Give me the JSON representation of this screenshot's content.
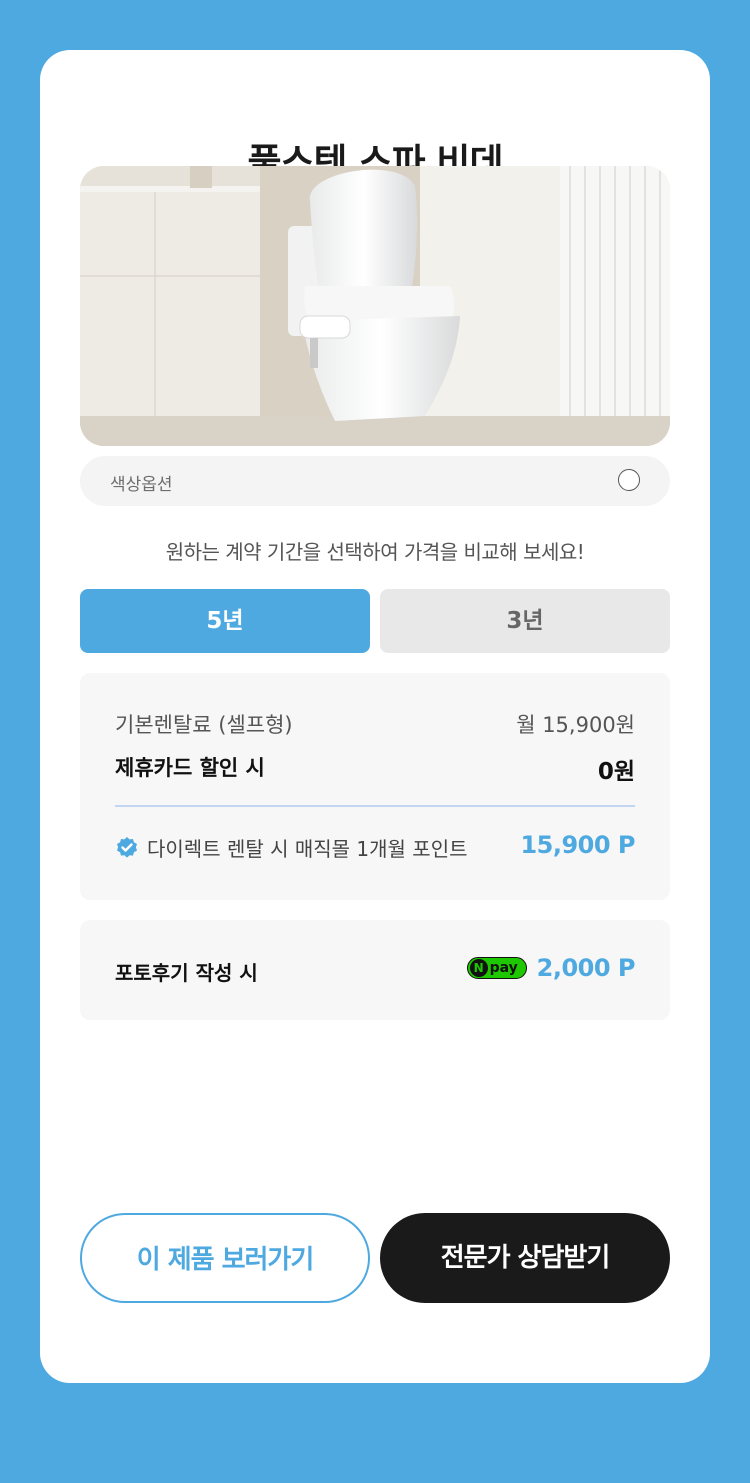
{
  "title": "풀스텐 스파 비데",
  "product_image": {
    "alt": "bidet-photo"
  },
  "color_option": {
    "label": "색상옵션"
  },
  "hint": "원하는 계약 기간을 선택하여 가격을 비교해 보세요!",
  "tabs": [
    {
      "label": "5년",
      "active": true
    },
    {
      "label": "3년",
      "active": false
    }
  ],
  "pricing": {
    "base_label": "기본렌탈료 (셀프형)",
    "base_value": "월 15,900원",
    "discount_label": "제휴카드 할인 시",
    "discount_value": "0원",
    "point_label": "다이렉트 렌탈 시 매직몰 1개월 포인트",
    "point_value": "15,900 P"
  },
  "review": {
    "label": "포토후기 작성 시",
    "npay_badge": "pay",
    "npay_n": "N",
    "points": "2,000 P"
  },
  "buttons": {
    "view_product": "이 제품 보러가기",
    "consult": "전문가 상담받기"
  },
  "colors": {
    "accent": "#4fa9e1",
    "dark": "#1a1a1a",
    "npay_green": "#1ec800"
  }
}
